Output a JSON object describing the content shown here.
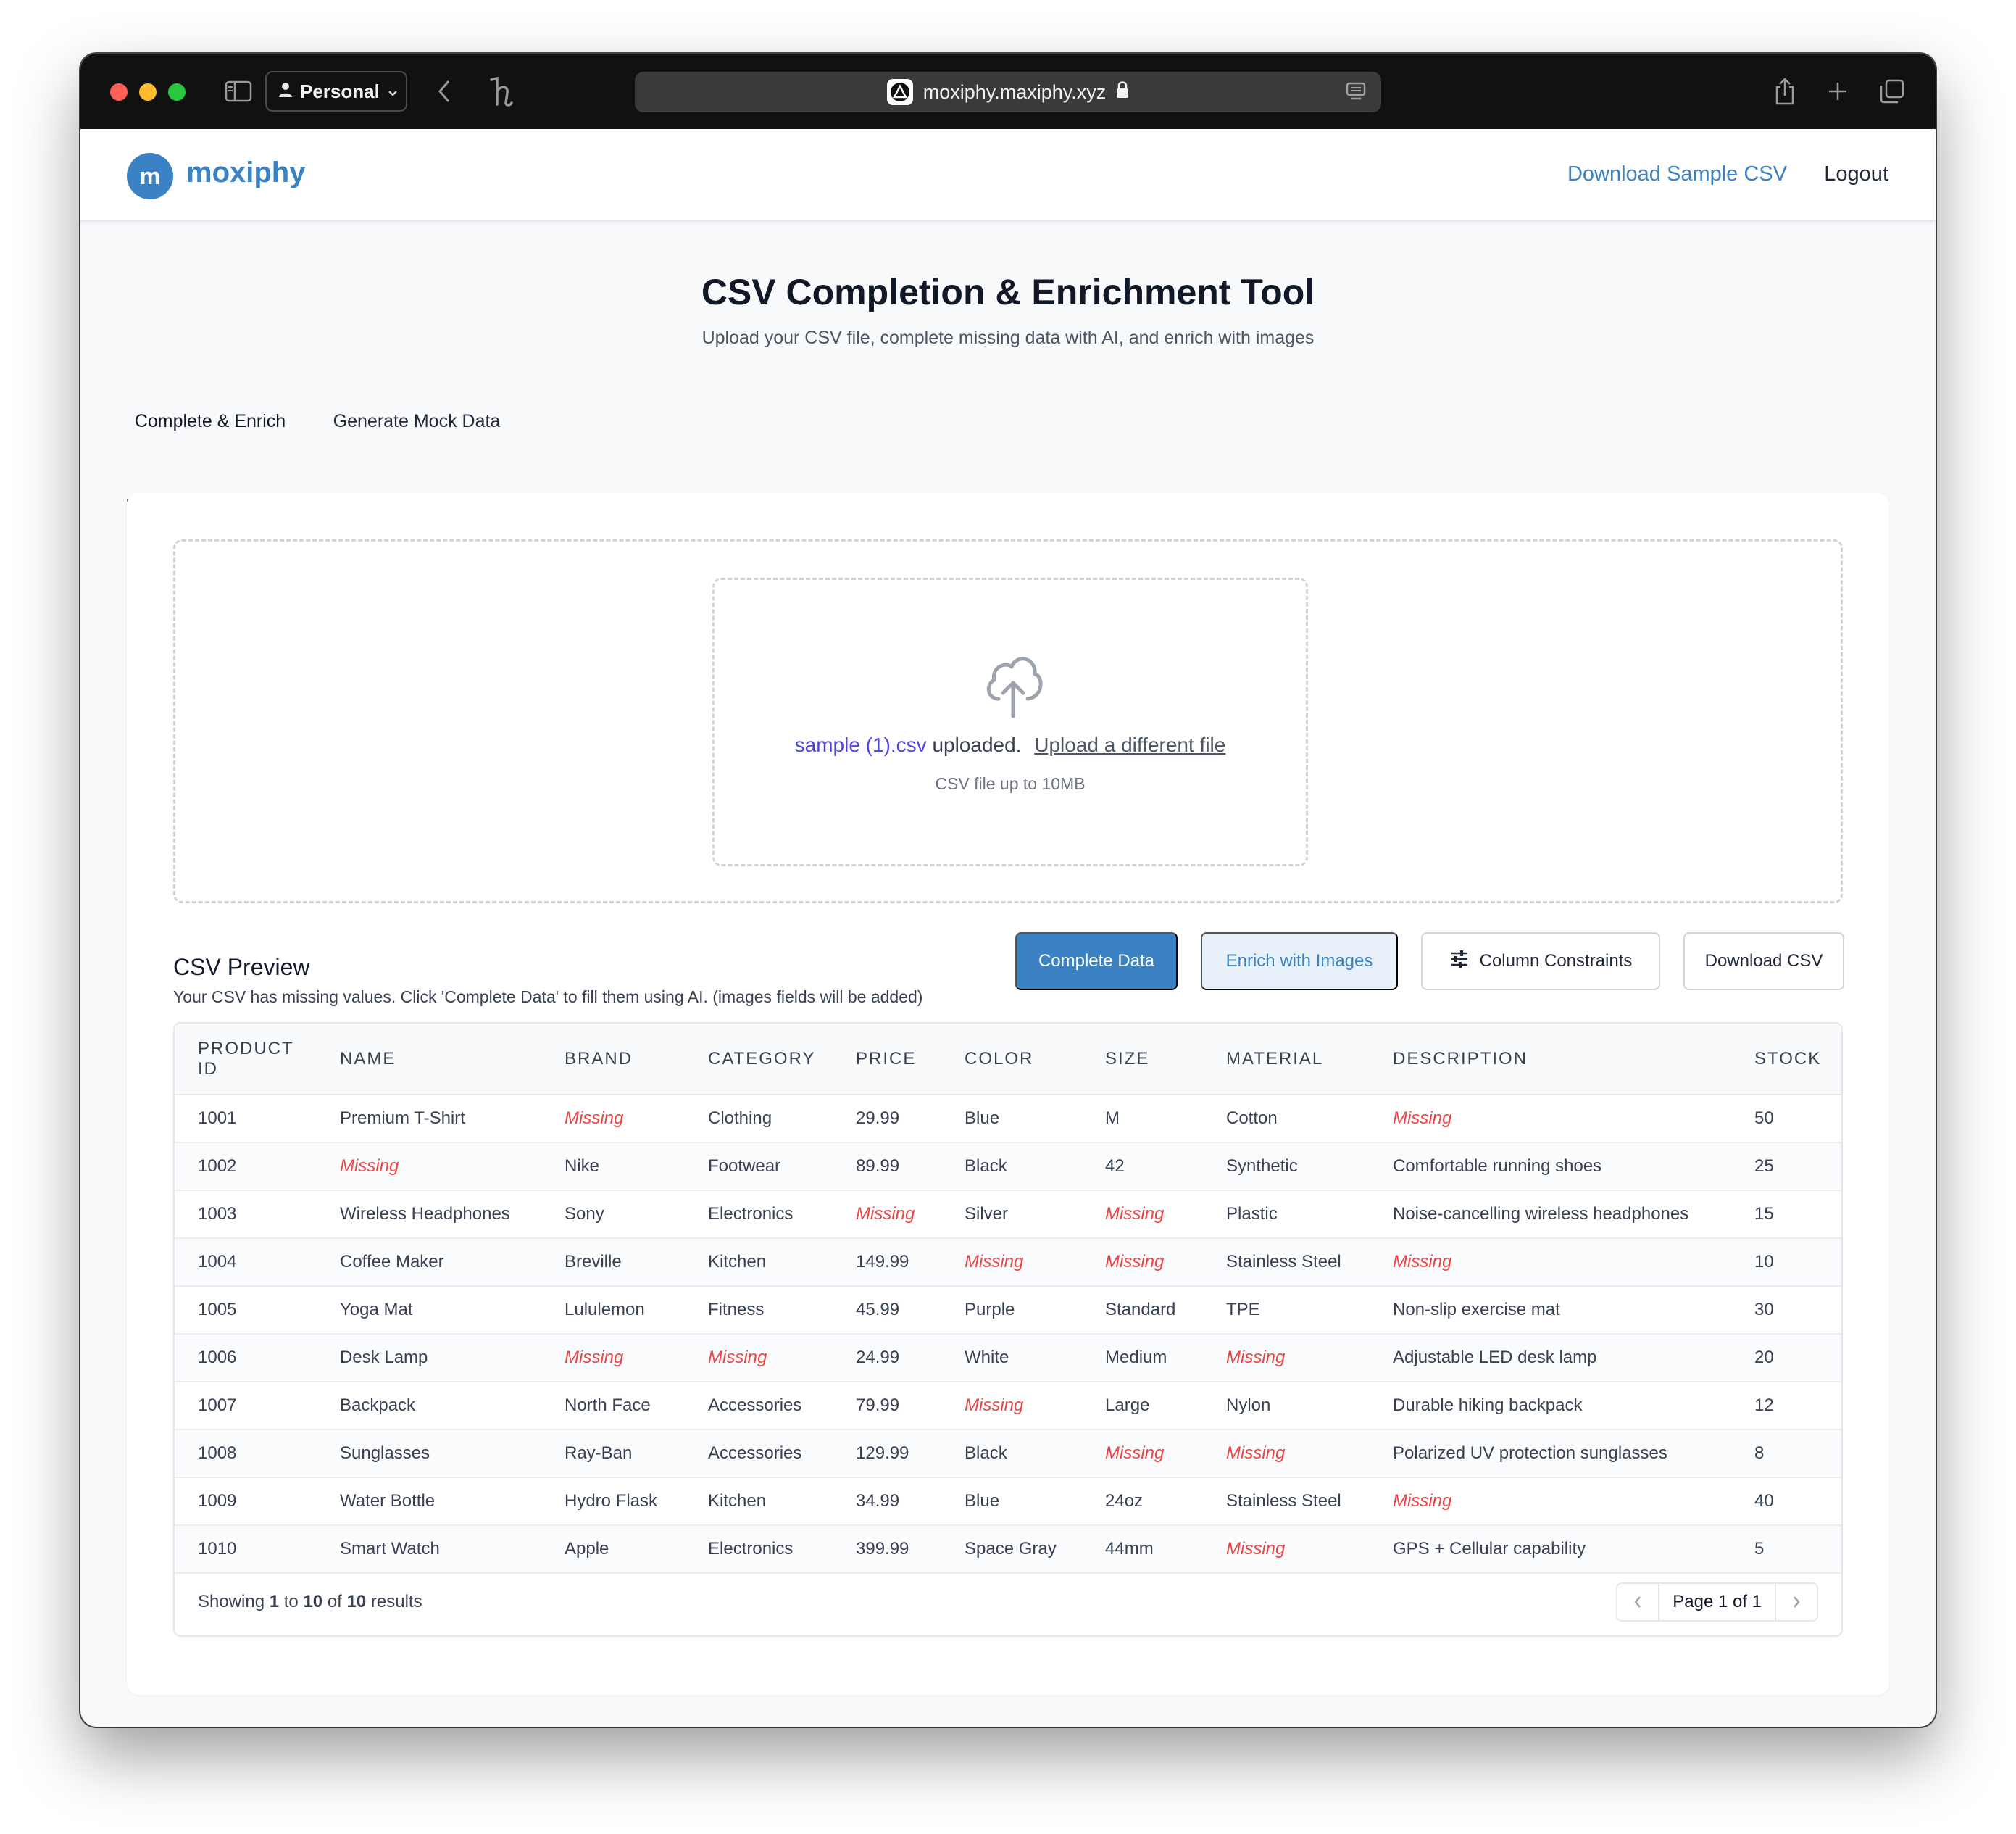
{
  "browser": {
    "profile_label": "Personal",
    "url": "moxiphy.maxiphy.xyz"
  },
  "header": {
    "logo_letter": "m",
    "logo_text": "moxiphy",
    "nav_sample": "Download Sample CSV",
    "nav_logout": "Logout"
  },
  "page": {
    "title": "CSV Completion & Enrichment Tool",
    "subtitle": "Upload your CSV file, complete missing data with AI, and enrich with images"
  },
  "tabs": [
    {
      "label": "Complete & Enrich",
      "active": true
    },
    {
      "label": "Generate Mock Data",
      "active": false
    }
  ],
  "upload": {
    "file_name": "sample (1).csv",
    "uploaded_text": " uploaded.",
    "different_file_link": "Upload a different file",
    "hint": "CSV file up to 10MB"
  },
  "preview": {
    "title": "CSV Preview",
    "description": "Your CSV has missing values. Click 'Complete Data' to fill them using AI. (images fields will be added)",
    "buttons": {
      "complete": "Complete Data",
      "enrich": "Enrich with Images",
      "constraints": "Column Constraints",
      "download": "Download CSV"
    }
  },
  "table": {
    "headers": [
      "PRODUCT ID",
      "NAME",
      "BRAND",
      "CATEGORY",
      "PRICE",
      "COLOR",
      "SIZE",
      "MATERIAL",
      "DESCRIPTION",
      "STOCK"
    ],
    "missing_label": "Missing",
    "rows": [
      [
        "1001",
        "Premium T-Shirt",
        null,
        "Clothing",
        "29.99",
        "Blue",
        "M",
        "Cotton",
        null,
        "50"
      ],
      [
        "1002",
        null,
        "Nike",
        "Footwear",
        "89.99",
        "Black",
        "42",
        "Synthetic",
        "Comfortable running shoes",
        "25"
      ],
      [
        "1003",
        "Wireless Headphones",
        "Sony",
        "Electronics",
        null,
        "Silver",
        null,
        "Plastic",
        "Noise-cancelling wireless headphones",
        "15"
      ],
      [
        "1004",
        "Coffee Maker",
        "Breville",
        "Kitchen",
        "149.99",
        null,
        null,
        "Stainless Steel",
        null,
        "10"
      ],
      [
        "1005",
        "Yoga Mat",
        "Lululemon",
        "Fitness",
        "45.99",
        "Purple",
        "Standard",
        "TPE",
        "Non-slip exercise mat",
        "30"
      ],
      [
        "1006",
        "Desk Lamp",
        null,
        null,
        "24.99",
        "White",
        "Medium",
        null,
        "Adjustable LED desk lamp",
        "20"
      ],
      [
        "1007",
        "Backpack",
        "North Face",
        "Accessories",
        "79.99",
        null,
        "Large",
        "Nylon",
        "Durable hiking backpack",
        "12"
      ],
      [
        "1008",
        "Sunglasses",
        "Ray-Ban",
        "Accessories",
        "129.99",
        "Black",
        null,
        null,
        "Polarized UV protection sunglasses",
        "8"
      ],
      [
        "1009",
        "Water Bottle",
        "Hydro Flask",
        "Kitchen",
        "34.99",
        "Blue",
        "24oz",
        "Stainless Steel",
        null,
        "40"
      ],
      [
        "1010",
        "Smart Watch",
        "Apple",
        "Electronics",
        "399.99",
        "Space Gray",
        "44mm",
        null,
        "GPS + Cellular capability",
        "5"
      ]
    ],
    "footer": {
      "showing_prefix": "Showing ",
      "from": "1",
      "to_word": " to ",
      "to": "10",
      "of_word": " of ",
      "total": "10",
      "results_word": " results"
    },
    "pagination": {
      "label": "Page 1 of 1"
    }
  },
  "colors": {
    "accent": "#3b82c4",
    "missing": "#ef4444",
    "file_link": "#4f46e5"
  }
}
